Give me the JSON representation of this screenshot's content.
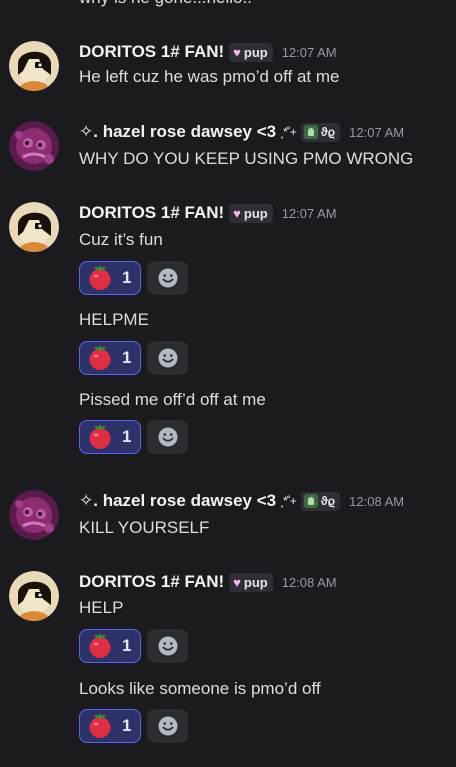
{
  "top_partial_text": "why is he gone...hello..",
  "users": {
    "doritos": {
      "name": "DORITOS 1# FAN!",
      "tag": "pup"
    },
    "hazel": {
      "name": "✧. hazel rose dawsey <3",
      "decor": "˳*˚+",
      "tag": "ϑϱ"
    }
  },
  "messages": [
    {
      "time": "12:07 AM",
      "lines": [
        "He left cuz he was pmo’d off at me"
      ]
    },
    {
      "time": "12:07 AM",
      "lines": [
        "WHY DO YOU KEEP USING PMO WRONG"
      ]
    },
    {
      "time": "12:07 AM",
      "lines": [
        "Cuz it’s fun",
        "HELPME",
        "Pissed me off’d off at me"
      ]
    },
    {
      "time": "12:08 AM",
      "lines": [
        "KILL YOURSELF"
      ]
    },
    {
      "time": "12:08 AM",
      "lines": [
        "HELP",
        "Looks like someone is pmo’d off"
      ]
    }
  ],
  "reaction": {
    "emoji": "tomato-emoji",
    "count": "1"
  },
  "icons": {
    "add_reaction": "smiley-add-icon"
  },
  "colors": {
    "background": "#1b1b1f",
    "reaction_bg": "#2f3268",
    "reaction_border": "#5865f2",
    "timestamp": "#949ba4"
  }
}
